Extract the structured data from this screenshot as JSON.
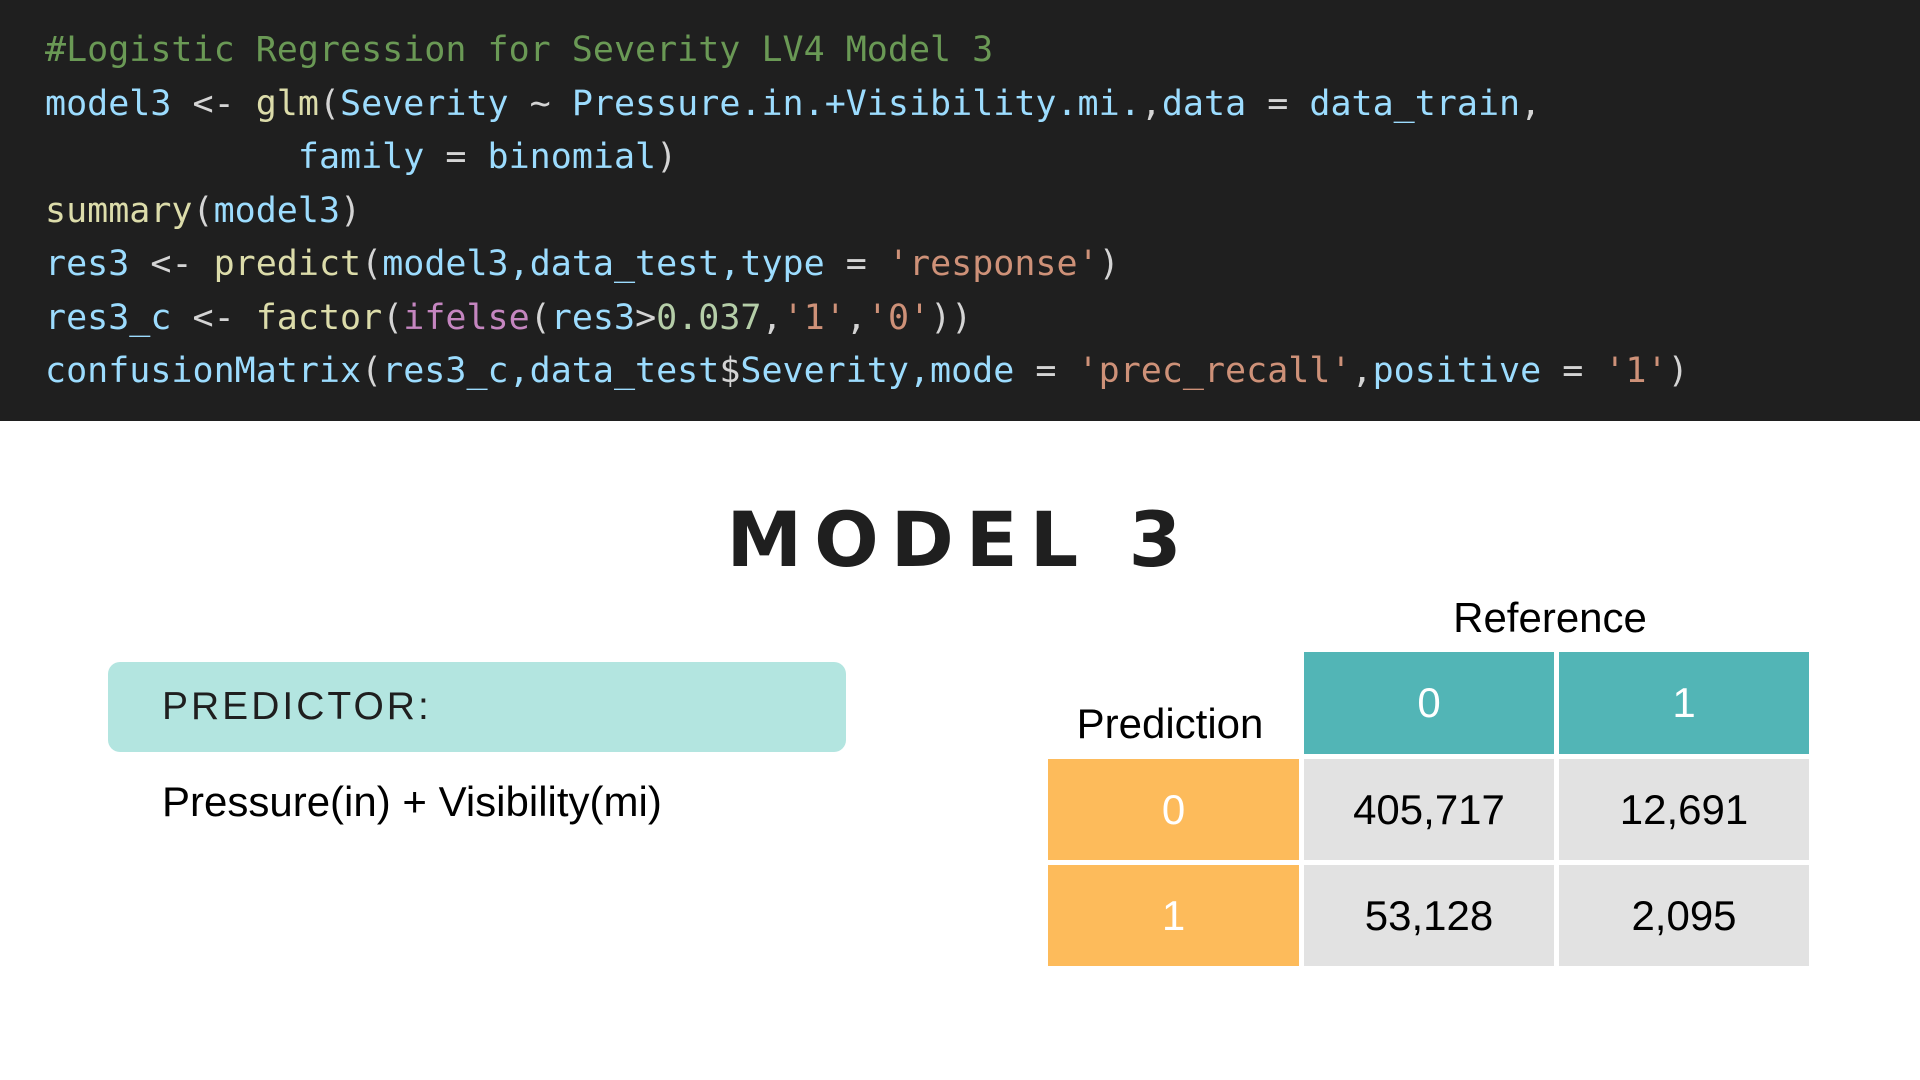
{
  "code": {
    "line1": {
      "comment": "#Logistic Regression for Severity LV4 Model 3"
    },
    "line2": {
      "var": "model3",
      "assign": " <- ",
      "fn": "glm",
      "open": "(",
      "arg1": "Severity",
      "tilde": " ~ ",
      "formula": "Pressure.in.+Visibility.mi.",
      "comma1": ",",
      "arg2": "data",
      "eq1": " = ",
      "val2": "data_train",
      "comma2": ","
    },
    "line3": {
      "indent": "            ",
      "arg": "family",
      "eq": " = ",
      "val": "binomial",
      "close": ")"
    },
    "line4": {
      "fn": "summary",
      "open": "(",
      "arg": "model3",
      "close": ")"
    },
    "line5": {
      "var": "res3",
      "assign": " <- ",
      "fn": "predict",
      "open": "(",
      "args": "model3,data_test,type",
      "eq": " = ",
      "str": "'response'",
      "close": ")"
    },
    "line6": {
      "var": "res3_c",
      "assign": " <- ",
      "fn": "factor",
      "open1": "(",
      "kw": "ifelse",
      "open2": "(",
      "arg": "res3",
      "gt": ">",
      "num": "0.037",
      "comma1": ",",
      "str1": "'1'",
      "comma2": ",",
      "str2": "'0'",
      "close": "))"
    },
    "line7": {
      "fn": "confusionMatrix",
      "open": "(",
      "args1": "res3_c,data_test",
      "dollar": "$",
      "args2": "Severity,mode",
      "eq1": " = ",
      "str1": "'prec_recall'",
      "comma": ",",
      "arg3": "positive",
      "eq2": " = ",
      "str2": "'1'",
      "close": ")"
    }
  },
  "title": "MODEL 3",
  "predictor": {
    "label": "PREDICTOR:",
    "value": "Pressure(in) + Visibility(mi)"
  },
  "matrix": {
    "reference_label": "Reference",
    "prediction_label": "Prediction",
    "columns": [
      "0",
      "1"
    ],
    "rows": [
      {
        "label": "0",
        "values": [
          "405,717",
          "12,691"
        ]
      },
      {
        "label": "1",
        "values": [
          "53,128",
          "2,095"
        ]
      }
    ]
  },
  "colors": {
    "code_background": "#1f1f1f",
    "predictor_box": "#b3e5e0",
    "header_teal": "#52b5b6",
    "row_orange": "#fdbb5b",
    "cell_grey": "#e2e2e2"
  }
}
